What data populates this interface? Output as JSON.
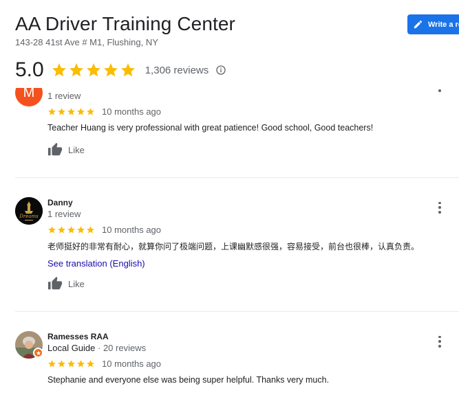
{
  "business": {
    "name": "AA Driver Training Center",
    "address": "143-28 41st Ave # M1, Flushing, NY",
    "rating": "5.0",
    "review_count": "1,306 reviews",
    "write_review_label": "Write a review"
  },
  "colors": {
    "star": "#fbbc04",
    "accent": "#1a73e8",
    "link": "#1a0dab",
    "avatar_m": "#f4511e",
    "local_guide_badge": "#f06f20"
  },
  "reviews": [
    {
      "avatar_letter": "M",
      "name": "",
      "meta": "1 review",
      "rating": 5,
      "time": "10 months ago",
      "text": "Teacher Huang  is very professional with great patience! Good school, Good teachers!",
      "like_label": "Like"
    },
    {
      "name": "Danny",
      "meta": "1 review",
      "rating": 5,
      "time": "10 months ago",
      "text": "老师挺好的非常有耐心，就算你问了极端问题，上课幽默感很强，容易接受，前台也很棒，认真负责。",
      "translation_link": "See translation (English)",
      "like_label": "Like",
      "avatar_logo_text": "Dreams"
    },
    {
      "name": "Ramesses RAA",
      "meta_guide": "Local Guide",
      "meta_sep": " · ",
      "meta_count": "20 reviews",
      "rating": 5,
      "time": "10 months ago",
      "text": "Stephanie and everyone else was being super helpful. Thanks very much."
    }
  ],
  "icons": {
    "star": "star-icon",
    "info": "info-icon",
    "pencil": "pencil-icon",
    "thumb": "thumbs-up-icon",
    "more": "more-vert-icon"
  }
}
